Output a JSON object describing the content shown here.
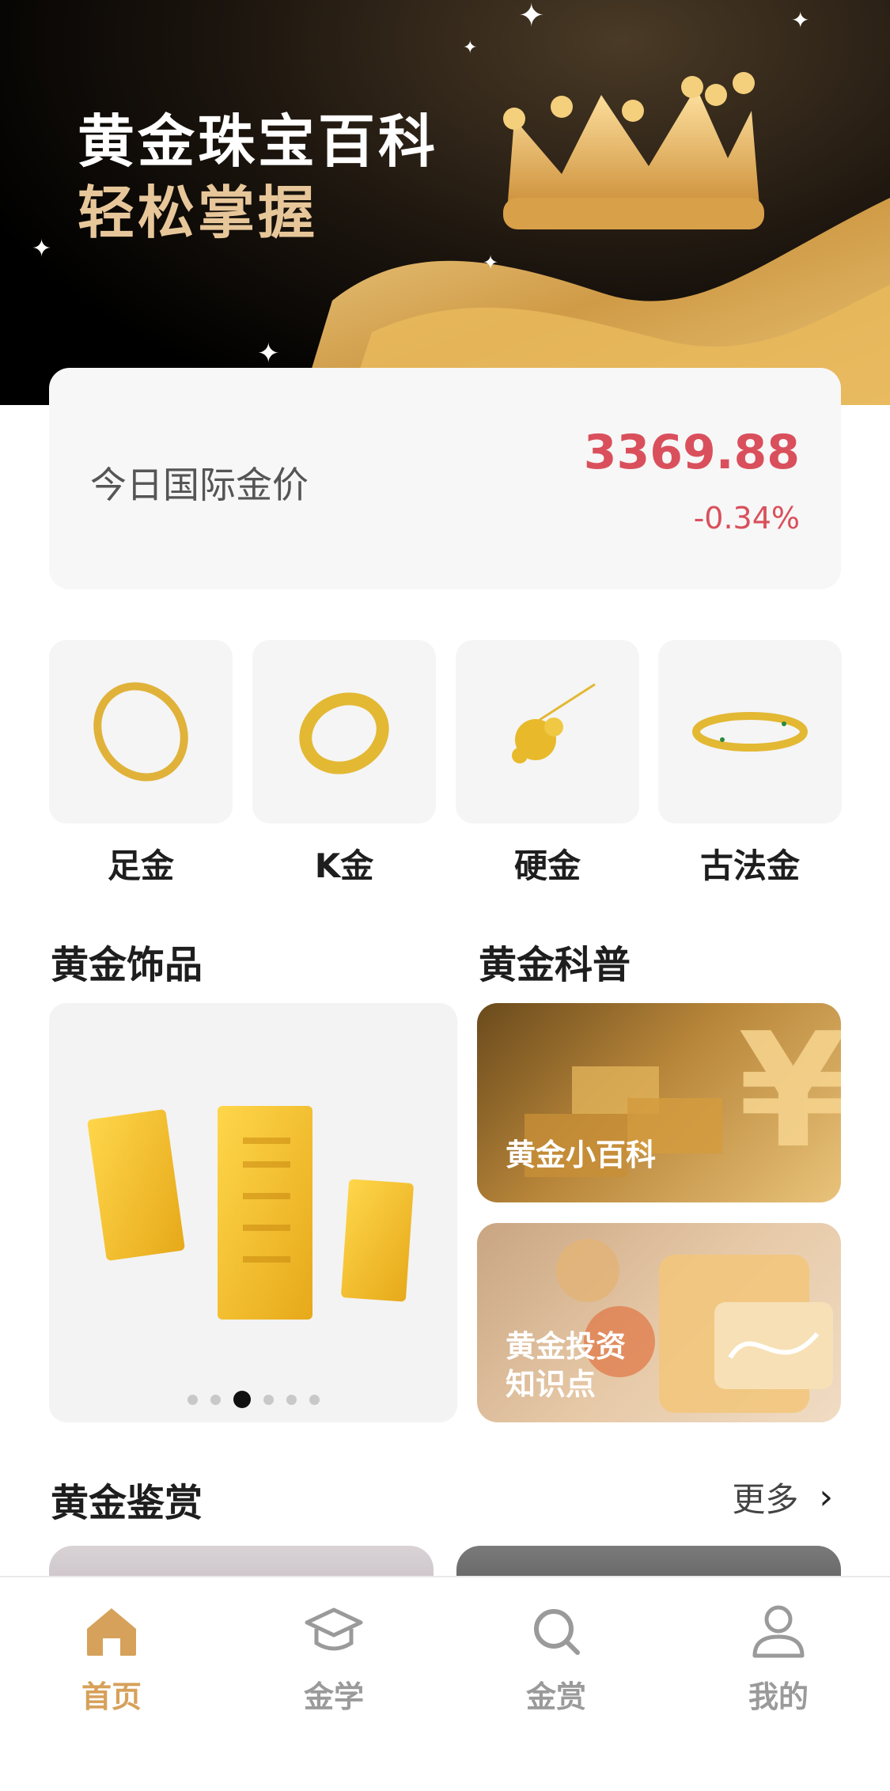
{
  "hero": {
    "title": "黄金珠宝百科",
    "subtitle": "轻松掌握"
  },
  "price": {
    "label": "今日国际金价",
    "value": "3369.88",
    "change": "-0.34%",
    "color": "#d9505c"
  },
  "categories": [
    {
      "label": "足金",
      "icon": "bangle-icon"
    },
    {
      "label": "K金",
      "icon": "ring-icon"
    },
    {
      "label": "硬金",
      "icon": "pendant-icon"
    },
    {
      "label": "古法金",
      "icon": "bracelet-icon"
    }
  ],
  "sections": {
    "jewelry": {
      "title": "黄金饰品",
      "carousel_total": 6,
      "carousel_active": 3
    },
    "science": {
      "title": "黄金科普",
      "cards": [
        {
          "label": "黄金小百科"
        },
        {
          "label": "黄金投资\n知识点"
        }
      ]
    },
    "appreciation": {
      "title": "黄金鉴赏",
      "more": "更多"
    }
  },
  "tabs": [
    {
      "label": "首页",
      "icon": "home-icon",
      "active": true
    },
    {
      "label": "金学",
      "icon": "graduation-cap-icon",
      "active": false
    },
    {
      "label": "金赏",
      "icon": "search-icon",
      "active": false
    },
    {
      "label": "我的",
      "icon": "user-icon",
      "active": false
    }
  ],
  "colors": {
    "accent": "#d6a15a",
    "price": "#d9505c",
    "inactive": "#9a9a9a"
  }
}
